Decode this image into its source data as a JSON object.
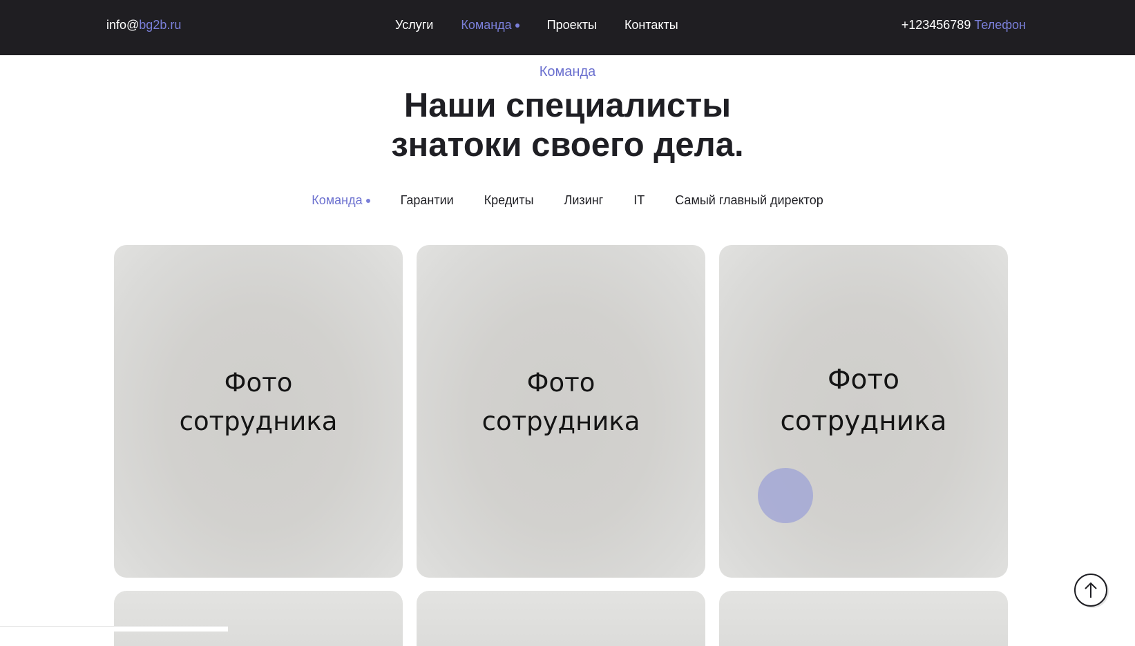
{
  "header": {
    "email_prefix": "info@",
    "email_domain": "bg2b.ru",
    "nav": [
      {
        "label": "Услуги",
        "active": false
      },
      {
        "label": "Команда",
        "active": true
      },
      {
        "label": "Проекты",
        "active": false
      },
      {
        "label": "Контакты",
        "active": false
      }
    ],
    "phone_number": "+123456789",
    "phone_label": "Телефон"
  },
  "section": {
    "eyebrow": "Команда",
    "title_line1": "Наши специалисты",
    "title_line2": "знатоки своего дела."
  },
  "tabs": [
    {
      "label": "Команда",
      "active": true
    },
    {
      "label": "Гарантии",
      "active": false
    },
    {
      "label": "Кредиты",
      "active": false
    },
    {
      "label": "Лизинг",
      "active": false
    },
    {
      "label": "IT",
      "active": false
    },
    {
      "label": "Самый главный директор",
      "active": false
    }
  ],
  "cards": [
    {
      "line1": "Фото",
      "line2": "сотрудника"
    },
    {
      "line1": "Фото",
      "line2": "сотрудника"
    },
    {
      "line1": "Фото",
      "line2": "сотрудника"
    }
  ],
  "colors": {
    "accent": "#7a7fd9",
    "header_bg": "#1f1e22"
  },
  "icons": {
    "scroll_top": "arrow-up-icon"
  }
}
